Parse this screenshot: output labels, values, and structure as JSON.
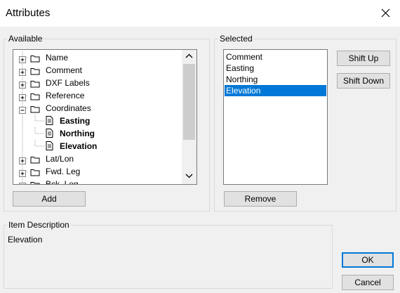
{
  "window": {
    "title": "Attributes"
  },
  "available": {
    "legend": "Available",
    "items": [
      {
        "label": "Name",
        "kind": "folder",
        "expander": "plus",
        "bold": false
      },
      {
        "label": "Comment",
        "kind": "folder",
        "expander": "plus",
        "bold": false
      },
      {
        "label": "DXF Labels",
        "kind": "folder",
        "expander": "plus",
        "bold": false
      },
      {
        "label": "Reference",
        "kind": "folder",
        "expander": "plus",
        "bold": false
      },
      {
        "label": "Coordinates",
        "kind": "folder",
        "expander": "minus",
        "bold": false
      },
      {
        "label": "Easting",
        "kind": "document",
        "bold": true
      },
      {
        "label": "Northing",
        "kind": "document",
        "bold": true
      },
      {
        "label": "Elevation",
        "kind": "document",
        "bold": true
      },
      {
        "label": "Lat/Lon",
        "kind": "folder",
        "expander": "plus",
        "bold": false
      },
      {
        "label": "Fwd. Leg",
        "kind": "folder",
        "expander": "plus",
        "bold": false
      },
      {
        "label": "Bck. Leg",
        "kind": "folder",
        "expander": "plus",
        "bold": false
      }
    ],
    "add_label": "Add"
  },
  "selected": {
    "legend": "Selected",
    "items": [
      "Comment",
      "Easting",
      "Northing",
      "Elevation"
    ],
    "selected_item": "Elevation",
    "shift_up_label": "Shift Up",
    "shift_down_label": "Shift Down",
    "remove_label": "Remove"
  },
  "description": {
    "legend": "Item Description",
    "text": "Elevation"
  },
  "buttons": {
    "ok_label": "OK",
    "cancel_label": "Cancel"
  },
  "colors": {
    "accent": "#0078d7",
    "background": "#f0f0f0",
    "titlebar": "#ffffff"
  },
  "icons": [
    "close-icon",
    "folder-icon",
    "document-icon",
    "plus-box-icon",
    "minus-box-icon",
    "chevron-up-icon",
    "chevron-down-icon"
  ]
}
